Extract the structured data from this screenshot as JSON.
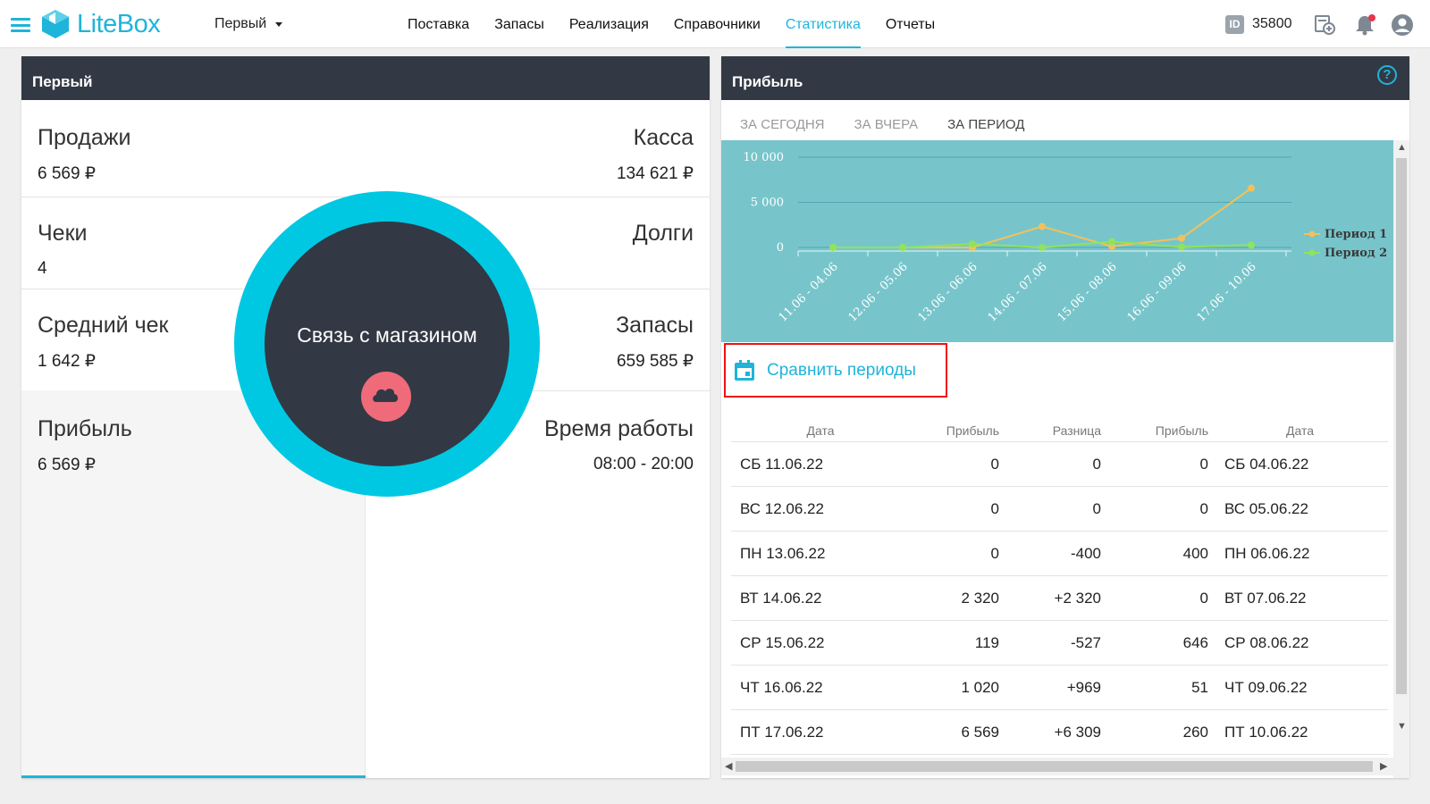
{
  "app": {
    "logo_text": "LiteBox",
    "accent_color": "#1fb4d9"
  },
  "topbar": {
    "store_select": "Первый",
    "nav": [
      {
        "label": "Поставка",
        "active": false
      },
      {
        "label": "Запасы",
        "active": false
      },
      {
        "label": "Реализация",
        "active": false
      },
      {
        "label": "Справочники",
        "active": false
      },
      {
        "label": "Статистика",
        "active": true
      },
      {
        "label": "Отчеты",
        "active": false
      }
    ],
    "id_badge": "ID",
    "id_value": "35800",
    "icons": [
      "add-document-icon",
      "bell-icon",
      "user-icon"
    ]
  },
  "store_panel": {
    "title": "Первый",
    "metrics": {
      "sales": {
        "label": "Продажи",
        "value": "6 569 ₽"
      },
      "cash": {
        "label": "Касса",
        "value": "134 621 ₽"
      },
      "receipts": {
        "label": "Чеки",
        "value": "4"
      },
      "debts": {
        "label": "Долги",
        "value": ""
      },
      "avg_check": {
        "label": "Средний чек",
        "value": "1 642 ₽"
      },
      "stock": {
        "label": "Запасы",
        "value": "659 585 ₽"
      },
      "profit": {
        "label": "Прибыль",
        "value": "6 569 ₽"
      },
      "hours": {
        "label": "Время работы",
        "value": "08:00 - 20:00"
      }
    },
    "overlay": {
      "title": "Связь с магазином",
      "icon": "cloud-icon",
      "ring_color": "#00c8e3",
      "button_color": "#ef6b79"
    }
  },
  "profit_panel": {
    "title": "Прибыль",
    "tabs": [
      {
        "label": "ЗА СЕГОДНЯ",
        "active": false
      },
      {
        "label": "ЗА ВЧЕРА",
        "active": false
      },
      {
        "label": "ЗА ПЕРИОД",
        "active": true
      }
    ],
    "compare_label": "Сравнить периоды",
    "table": {
      "headers": [
        "Дата",
        "Прибыль",
        "Разница",
        "Прибыль",
        "Дата"
      ],
      "rows": [
        [
          "СБ 11.06.22",
          "0",
          "0",
          "0",
          "СБ 04.06.22"
        ],
        [
          "ВС 12.06.22",
          "0",
          "0",
          "0",
          "ВС 05.06.22"
        ],
        [
          "ПН 13.06.22",
          "0",
          "-400",
          "400",
          "ПН 06.06.22"
        ],
        [
          "ВТ 14.06.22",
          "2 320",
          "+2 320",
          "0",
          "ВТ 07.06.22"
        ],
        [
          "СР 15.06.22",
          "119",
          "-527",
          "646",
          "СР 08.06.22"
        ],
        [
          "ЧТ 16.06.22",
          "1 020",
          "+969",
          "51",
          "ЧТ 09.06.22"
        ],
        [
          "ПТ 17.06.22",
          "6 569",
          "+6 309",
          "260",
          "ПТ 10.06.22"
        ]
      ]
    }
  },
  "chart_data": {
    "type": "line",
    "x": [
      "11.06 - 04.06",
      "12.06 - 05.06",
      "13.06 - 06.06",
      "14.06 - 07.06",
      "15.06 - 08.06",
      "16.06 - 09.06",
      "17.06 - 10.06"
    ],
    "y_ticks": [
      "10 000",
      "5 000",
      "0"
    ],
    "ylim": [
      0,
      10000
    ],
    "series": [
      {
        "name": "Период 1",
        "color": "#f2c15b",
        "values": [
          0,
          0,
          0,
          2320,
          119,
          1020,
          6569
        ]
      },
      {
        "name": "Период 2",
        "color": "#8fe45a",
        "values": [
          0,
          0,
          400,
          0,
          646,
          51,
          260
        ]
      }
    ],
    "legend": "right",
    "background": "#77c5cb"
  }
}
